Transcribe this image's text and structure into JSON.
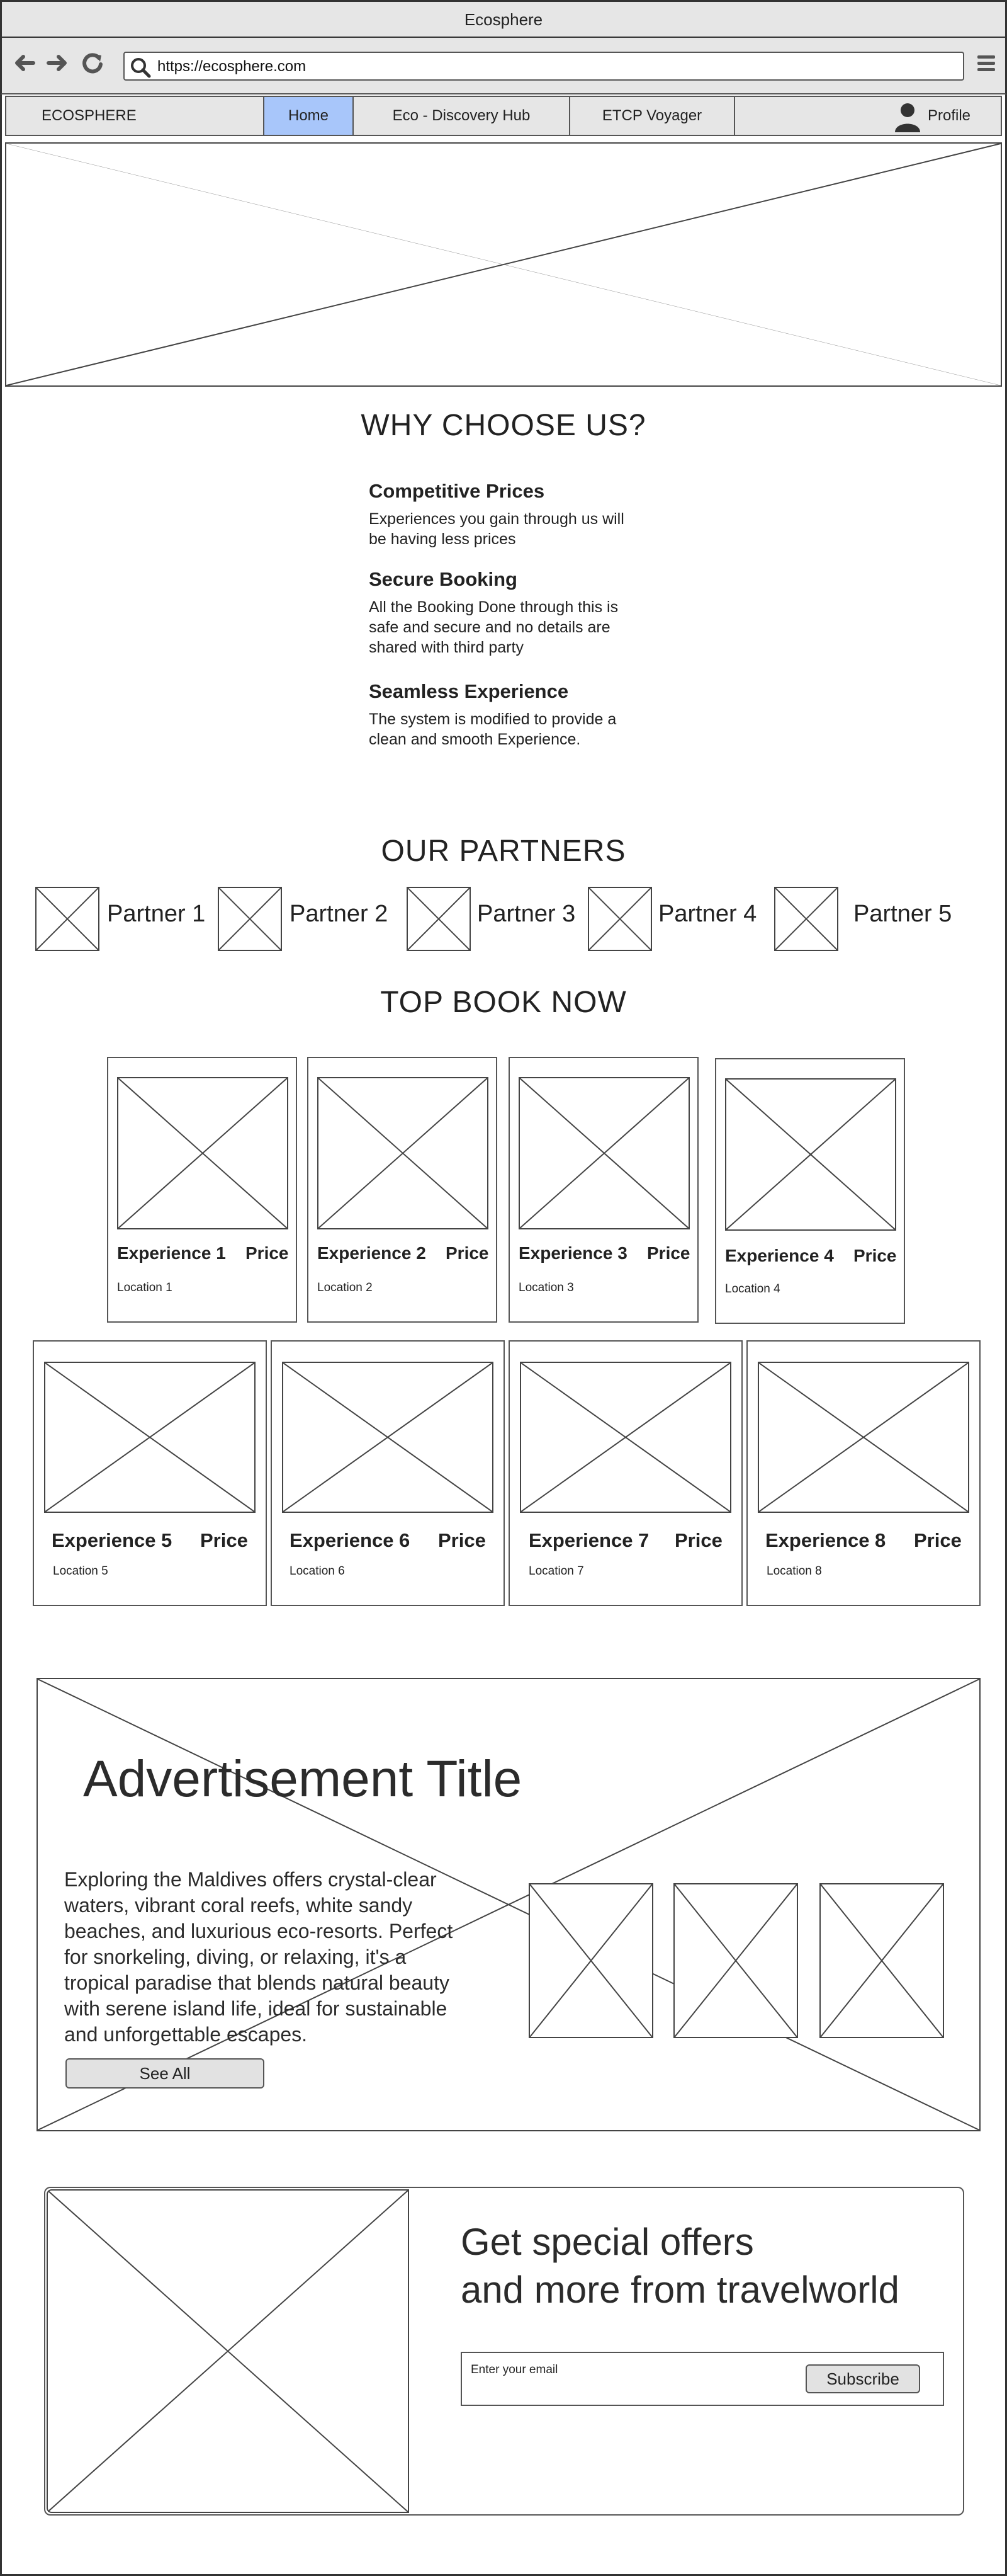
{
  "window": {
    "title": "Ecosphere"
  },
  "browser": {
    "url": "https://ecosphere.com",
    "icons": [
      "back-arrow-icon",
      "forward-arrow-icon",
      "reload-icon",
      "search-icon",
      "menu-icon"
    ]
  },
  "nav": {
    "brand": "ECOSPHERE",
    "items": [
      {
        "label": "Home",
        "active": true
      },
      {
        "label": "Eco - Discovery Hub",
        "active": false
      },
      {
        "label": "ETCP Voyager",
        "active": false
      }
    ],
    "profile_label": "Profile",
    "active_color": "#a8c6fa"
  },
  "why": {
    "heading": "WHY CHOOSE US?",
    "features": [
      {
        "title": "Competitive Prices",
        "desc_lines": [
          "Experiences you gain through us will",
          "be having less prices"
        ]
      },
      {
        "title": "Secure Booking",
        "desc_lines": [
          "All the Booking Done through this is",
          "safe and secure and no details are",
          "shared with third party"
        ]
      },
      {
        "title": "Seamless Experience",
        "desc_lines": [
          "The system is modified to provide a",
          "clean and smooth Experience."
        ]
      }
    ]
  },
  "partners": {
    "heading": "OUR PARTNERS",
    "items": [
      "Partner 1",
      "Partner 2",
      "Partner 3",
      "Partner 4",
      "Partner 5"
    ]
  },
  "top_book": {
    "heading": "TOP BOOK NOW",
    "experiences": [
      {
        "name": "Experience 1",
        "price": "Price",
        "location": "Location 1"
      },
      {
        "name": "Experience 2",
        "price": "Price",
        "location": "Location 2"
      },
      {
        "name": "Experience 3",
        "price": "Price",
        "location": "Location 3"
      },
      {
        "name": "Experience 4",
        "price": "Price",
        "location": "Location 4"
      },
      {
        "name": "Experience 5",
        "price": "Price",
        "location": "Location 5"
      },
      {
        "name": "Experience 6",
        "price": "Price",
        "location": "Location 6"
      },
      {
        "name": "Experience 7",
        "price": "Price",
        "location": "Location 7"
      },
      {
        "name": "Experience 8",
        "price": "Price",
        "location": "Location 8"
      }
    ]
  },
  "advertisement": {
    "title": "Advertisement Title",
    "text_lines": [
      "Exploring the Maldives offers crystal-clear",
      "waters, vibrant coral reefs, white sandy",
      "beaches, and luxurious eco-resorts. Perfect",
      "for snorkeling, diving, or relaxing, it's a",
      "tropical paradise that blends natural beauty",
      "with serene island life, ideal for sustainable",
      "and unforgettable escapes."
    ],
    "button_label": "See All"
  },
  "newsletter": {
    "title_lines": [
      "Get special offers",
      "and more from travelworld"
    ],
    "email_placeholder": "Enter your email",
    "subscribe_label": "Subscribe"
  }
}
